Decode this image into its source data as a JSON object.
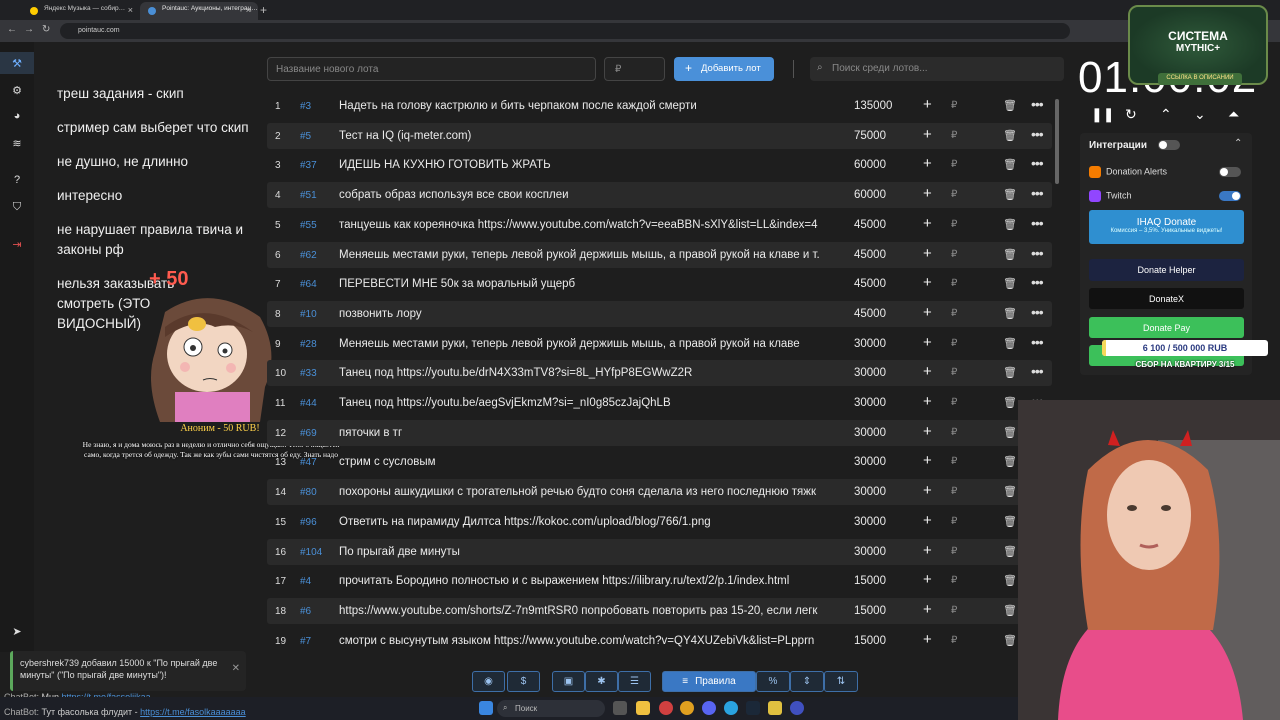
{
  "browser": {
    "tabs": [
      {
        "title": "Яндекс Музыка — собир…",
        "favicon_color": "#ffcc00"
      },
      {
        "title": "Pointauc: Аукционы, интеграц…",
        "favicon_color": "#4a8fd6"
      }
    ],
    "url": "pointauc.com"
  },
  "rules": {
    "items": [
      "треш задания - скип",
      "стример сам выберет что скип",
      "не душно, не длинно",
      "интересно",
      "не нарушает правила твича и законы рф",
      "нельзя заказывать смотреть (ЭТО ВИДОСНЫЙ)"
    ],
    "bonus": "+ 50"
  },
  "donation_alert": {
    "name": "Аноним - 50 RUB!",
    "message": "Не знаю, я и дома моюсь раз в неделю и отлично себя ощущаю. Тело очищается само, когда трется об одежду. Так же как зубы сами чистятся об еду. Знать надо"
  },
  "controls": {
    "lot_name_placeholder": "Название нового лота",
    "price_placeholder": "₽",
    "add_button": "Добавить лот",
    "search_placeholder": "Поиск среди лотов..."
  },
  "currency_symbol": "₽",
  "lots": [
    {
      "num": "1",
      "id": "#3",
      "name": "Надеть на голову кастрюлю и бить черпаком после каждой смерти",
      "amount": "135000"
    },
    {
      "num": "2",
      "id": "#5",
      "name": "Тест на IQ (iq-meter.com)",
      "amount": "75000"
    },
    {
      "num": "3",
      "id": "#37",
      "name": "ИДЕШЬ НА КУХНЮ ГОТОВИТЬ ЖРАТЬ",
      "amount": "60000"
    },
    {
      "num": "4",
      "id": "#51",
      "name": "собрать образ используя все свои косплеи",
      "amount": "60000"
    },
    {
      "num": "5",
      "id": "#55",
      "name": "танцуешь как кореяночка https://www.youtube.com/watch?v=eeaBBN-sXlY&list=LL&index=4",
      "amount": "45000"
    },
    {
      "num": "6",
      "id": "#62",
      "name": "Меняешь местами руки, теперь левой рукой держишь мышь, а правой рукой на клаве и т.",
      "amount": "45000"
    },
    {
      "num": "7",
      "id": "#64",
      "name": "ПЕРЕВЕСТИ МНЕ 50к за моральный ущерб",
      "amount": "45000"
    },
    {
      "num": "8",
      "id": "#10",
      "name": "позвонить лору",
      "amount": "45000"
    },
    {
      "num": "9",
      "id": "#28",
      "name": "Меняешь местами руки, теперь левой рукой держишь мышь, а правой рукой на клаве",
      "amount": "30000"
    },
    {
      "num": "10",
      "id": "#33",
      "name": "Танец под https://youtu.be/drN4X33mTV8?si=8L_HYfpP8EGWwZ2R",
      "amount": "30000"
    },
    {
      "num": "11",
      "id": "#44",
      "name": "Танец под https://youtu.be/aegSvjEkmzM?si=_nI0g85czJajQhLB",
      "amount": "30000"
    },
    {
      "num": "12",
      "id": "#69",
      "name": "пяточки в тг",
      "amount": "30000"
    },
    {
      "num": "13",
      "id": "#47",
      "name": "стрим с сусловым",
      "amount": "30000"
    },
    {
      "num": "14",
      "id": "#80",
      "name": "похороны ашкудишки с трогательной речью будто соня сделала из него последнюю тяжк",
      "amount": "30000"
    },
    {
      "num": "15",
      "id": "#96",
      "name": "Ответить на пирамиду  Дилтса  https://kokoc.com/upload/blog/766/1.png",
      "amount": "30000"
    },
    {
      "num": "16",
      "id": "#104",
      "name": " По прыгай две минуты",
      "amount": "30000"
    },
    {
      "num": "17",
      "id": "#4",
      "name": "прочитать Бородино полностью и с выражением https://ilibrary.ru/text/2/p.1/index.html",
      "amount": "15000"
    },
    {
      "num": "18",
      "id": "#6",
      "name": "https://www.youtube.com/shorts/Z-7n9mtRSR0 попробовать повторить раз 15-20, если легк",
      "amount": "15000"
    },
    {
      "num": "19",
      "id": "#7",
      "name": "смотри с высунутым языком https://www.youtube.com/watch?v=QY4XUZebiVk&list=PLpprn",
      "amount": "15000"
    }
  ],
  "bottom_toolbar": {
    "rules_button": "Правила",
    "percent_button": "%"
  },
  "timer": {
    "value": "01:00:02"
  },
  "integrations": {
    "title": "Интеграции",
    "services": [
      {
        "name": "Donation Alerts",
        "enabled": false,
        "color": "#f57c00"
      },
      {
        "name": "Twitch",
        "enabled": true,
        "color": "#9146ff"
      }
    ],
    "buttons": [
      {
        "label": "IHAQ Donate",
        "sub": "Комиссия – 3,5%. Уникальные виджеты!",
        "color": "#2f8fd0"
      },
      {
        "label": "Donate Helper",
        "color": "#1c2340"
      },
      {
        "label": "DonateX",
        "color": "#111111"
      },
      {
        "label": "Donate Pay",
        "color": "#3cc05a"
      }
    ]
  },
  "branding": {
    "line1": "СИСТЕМА",
    "line2": "MYTHIC+",
    "line3": "ССЫЛКА В ОПИСАНИИ"
  },
  "goal": {
    "progress_text": "6 100 / 500 000 RUB",
    "subtitle": "СБОР НА КВАРТИРУ 3/15",
    "fraction": 0.0122
  },
  "chat": {
    "popup": "cybershrek739 добавил 15000 к \"По прыгай две минуты\" (\"По прыгай две минуты\")!",
    "lines": [
      {
        "user": "ChatBot: ",
        "text": "Mun  ",
        "link": "https://t.me/fassoliikaa"
      },
      {
        "user": "ChatBot: ",
        "text": "Тут фасолька флудит - ",
        "link": "https://t.me/fasolkaaaaaaa"
      }
    ]
  },
  "taskbar": {
    "search_placeholder": "Поиск"
  }
}
